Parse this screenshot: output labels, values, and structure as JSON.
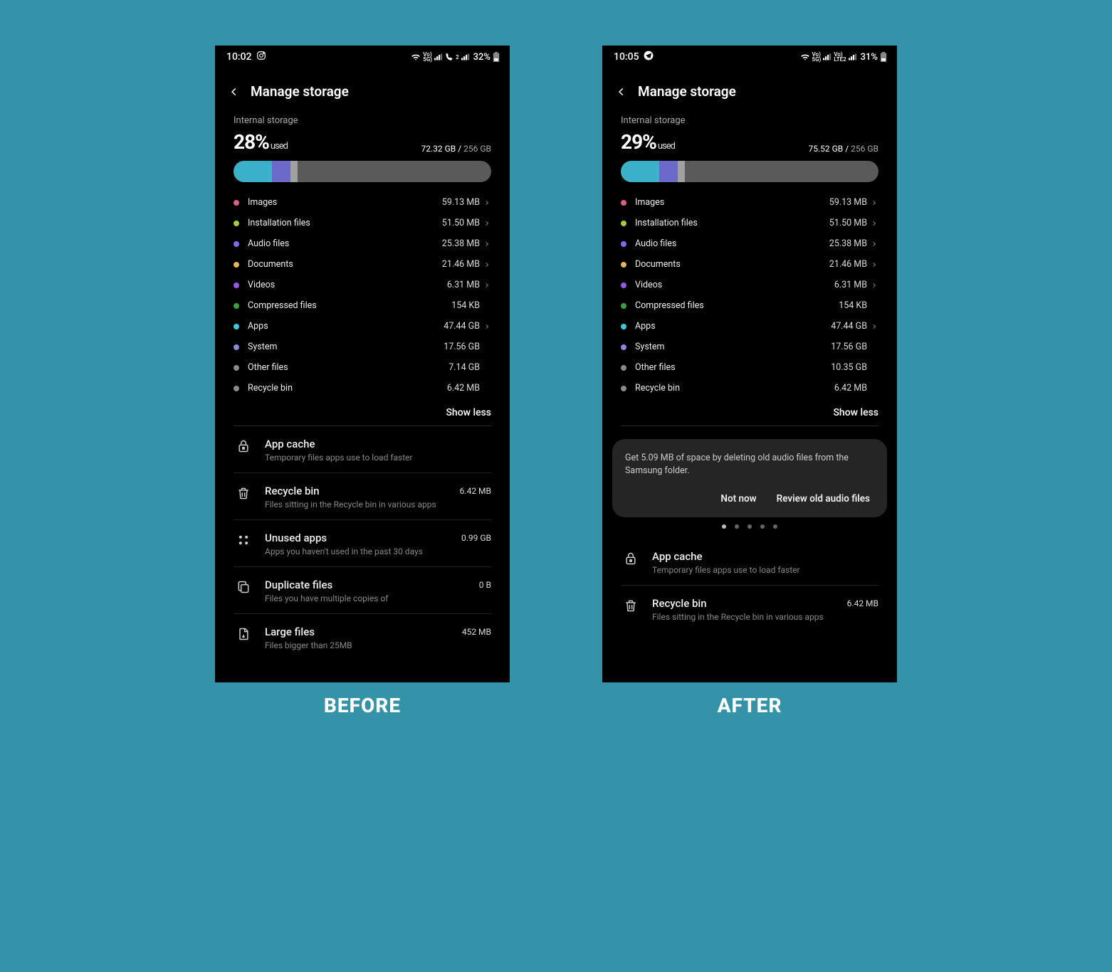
{
  "captions": {
    "before": "BEFORE",
    "after": "AFTER"
  },
  "common": {
    "title": "Manage storage",
    "internal": "Internal storage",
    "used_label": "used",
    "show_less": "Show less"
  },
  "bar_segments": [
    {
      "color": "#3bb0c9",
      "pct": 15
    },
    {
      "color": "#6b69c9",
      "pct": 7
    },
    {
      "color": "#a1a1a1",
      "pct": 3
    }
  ],
  "cat_colors": {
    "images": "#e05a8b",
    "install": "#a2d03a",
    "audio": "#7b6cf0",
    "docs": "#e6b55a",
    "videos": "#9b55e6",
    "compressed": "#3aa03a",
    "apps": "#3ac9e0",
    "system": "#8a8adf",
    "other": "#8a8a8a",
    "recycle": "#8a8a8a"
  },
  "before": {
    "time": "10:02",
    "battery": "32%",
    "net_label": "Voʄ\n5Gʄ",
    "percent": "28%",
    "used": "72.32 GB",
    "total": "256 GB",
    "categories": [
      {
        "key": "images",
        "label": "Images",
        "size": "59.13 MB",
        "nav": true
      },
      {
        "key": "install",
        "label": "Installation files",
        "size": "51.50 MB",
        "nav": true
      },
      {
        "key": "audio",
        "label": "Audio files",
        "size": "25.38 MB",
        "nav": true
      },
      {
        "key": "docs",
        "label": "Documents",
        "size": "21.46 MB",
        "nav": true
      },
      {
        "key": "videos",
        "label": "Videos",
        "size": "6.31 MB",
        "nav": true
      },
      {
        "key": "compressed",
        "label": "Compressed files",
        "size": "154 KB",
        "nav": false
      },
      {
        "key": "apps",
        "label": "Apps",
        "size": "47.44 GB",
        "nav": true
      },
      {
        "key": "system",
        "label": "System",
        "size": "17.56 GB",
        "nav": false
      },
      {
        "key": "other",
        "label": "Other files",
        "size": "7.14 GB",
        "nav": false
      },
      {
        "key": "recycle",
        "label": "Recycle bin",
        "size": "6.42 MB",
        "nav": false
      }
    ],
    "actions": [
      {
        "icon": "lock",
        "title": "App cache",
        "sub": "Temporary files apps use to load faster",
        "meta": ""
      },
      {
        "icon": "trash",
        "title": "Recycle bin",
        "sub": "Files sitting in the Recycle bin in various apps",
        "meta": "6.42 MB"
      },
      {
        "icon": "grid",
        "title": "Unused apps",
        "sub": "Apps you haven't used in the past 30 days",
        "meta": "0.99 GB"
      },
      {
        "icon": "copy",
        "title": "Duplicate files",
        "sub": "Files you have multiple copies of",
        "meta": "0 B"
      },
      {
        "icon": "file",
        "title": "Large files",
        "sub": "Files bigger than 25MB",
        "meta": "452 MB"
      }
    ]
  },
  "after": {
    "time": "10:05",
    "battery": "31%",
    "net_label": "Voʄ\nLTE2",
    "percent": "29%",
    "used": "75.52 GB",
    "total": "256 GB",
    "categories": [
      {
        "key": "images",
        "label": "Images",
        "size": "59.13 MB",
        "nav": true
      },
      {
        "key": "install",
        "label": "Installation files",
        "size": "51.50 MB",
        "nav": true
      },
      {
        "key": "audio",
        "label": "Audio files",
        "size": "25.38 MB",
        "nav": true
      },
      {
        "key": "docs",
        "label": "Documents",
        "size": "21.46 MB",
        "nav": true
      },
      {
        "key": "videos",
        "label": "Videos",
        "size": "6.31 MB",
        "nav": true
      },
      {
        "key": "compressed",
        "label": "Compressed files",
        "size": "154 KB",
        "nav": false
      },
      {
        "key": "apps",
        "label": "Apps",
        "size": "47.44 GB",
        "nav": true
      },
      {
        "key": "system",
        "label": "System",
        "size": "17.56 GB",
        "nav": false
      },
      {
        "key": "other",
        "label": "Other files",
        "size": "10.35 GB",
        "nav": false
      },
      {
        "key": "recycle",
        "label": "Recycle bin",
        "size": "6.42 MB",
        "nav": false
      }
    ],
    "card": {
      "msg": "Get 5.09 MB of space by deleting old audio files from the Samsung folder.",
      "not_now": "Not now",
      "review": "Review old audio files"
    },
    "actions": [
      {
        "icon": "lock",
        "title": "App cache",
        "sub": "Temporary files apps use to load faster",
        "meta": ""
      },
      {
        "icon": "trash",
        "title": "Recycle bin",
        "sub": "Files sitting in the Recycle bin in various apps",
        "meta": "6.42 MB"
      }
    ]
  }
}
